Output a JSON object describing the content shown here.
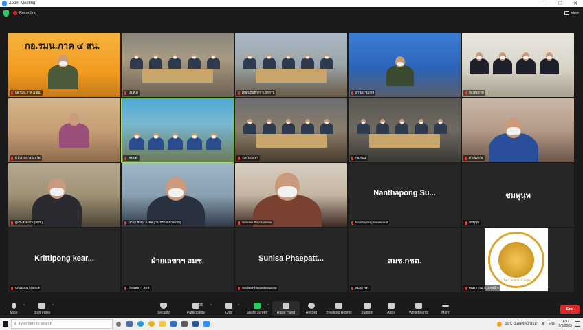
{
  "window": {
    "title": "Zoom Meeting",
    "controls": [
      "—",
      "❐",
      "✕"
    ]
  },
  "topbar": {
    "recording_label": "Recording",
    "view_label": "View"
  },
  "tiles": [
    {
      "name": "กอ.รมน.ภาค ๔ สน.",
      "banner": "กอ.รมน.ภาค ๔ สน.",
      "scene": "orange"
    },
    {
      "name": "ปธ.ศ.ศ",
      "scene": "room1"
    },
    {
      "name": "ศูนย์ปฏิบัติการ จ.ปัตตานี",
      "scene": "room2"
    },
    {
      "name": "สำนักงานภาค",
      "scene": "blue"
    },
    {
      "name": "กองทัพภาค",
      "scene": "white"
    },
    {
      "name": "ผู้ว่าราชการจังหวัด",
      "scene": "woman"
    },
    {
      "name": "ศอ.บต.",
      "scene": "stage",
      "active": true
    },
    {
      "name": "จังหวัดยะลา",
      "scene": "room3"
    },
    {
      "name": "กอ.รมน.",
      "scene": "dark"
    },
    {
      "name": "ฝ่ายจังหวัด",
      "scene": "curtain"
    },
    {
      "name": "ผู้ประสานงาน (กพร.)",
      "scene": "man1"
    },
    {
      "name": "นายก ชัยมุ่ง มงคล (กระทรวงมหาดไทย)",
      "scene": "man2"
    },
    {
      "name": "Somsak Prachaseree",
      "scene": "man3"
    },
    {
      "name": "Nanthapong Suwanarat",
      "big": "Nanthapong Su...",
      "scene": "none"
    },
    {
      "name": "ชมพูนุท",
      "big": "ชมพูนุท",
      "scene": "none"
    },
    {
      "name": "Krittipong kearsuk",
      "big": "Krittipong kear...",
      "scene": "none"
    },
    {
      "name": "ฝ่ายเลขาฯ สมช.",
      "big": "ฝ่ายเลขาฯ สมช.",
      "scene": "none"
    },
    {
      "name": "Sunisa Phaepattanapong",
      "big": "Sunisa Phaepatt...",
      "scene": "none"
    },
    {
      "name": "สมช.กชต.",
      "big": "สมช.กชต.",
      "scene": "none"
    },
    {
      "name": "คณะกรรมการกฤษฎีกา",
      "scene": "emblem",
      "emblem_text": "The Council of State"
    }
  ],
  "toolbar": {
    "mute": "Mute",
    "stop_video": "Stop Video",
    "security": "Security",
    "participants": "Participants",
    "participants_count": "20",
    "chat": "Chat",
    "share_screen": "Share Screen",
    "raise_hand": "Raise Hand",
    "record": "Record",
    "breakout_rooms": "Breakout Rooms",
    "support": "Support",
    "apps": "Apps",
    "whiteboards": "Whiteboards",
    "more": "More",
    "end": "End"
  },
  "taskbar": {
    "search_placeholder": "Type here to search",
    "weather": "33°C มีแดดจัดบ้างแล้ว",
    "lang": "ENG",
    "time": "14:12",
    "date": "2/9/2565"
  }
}
